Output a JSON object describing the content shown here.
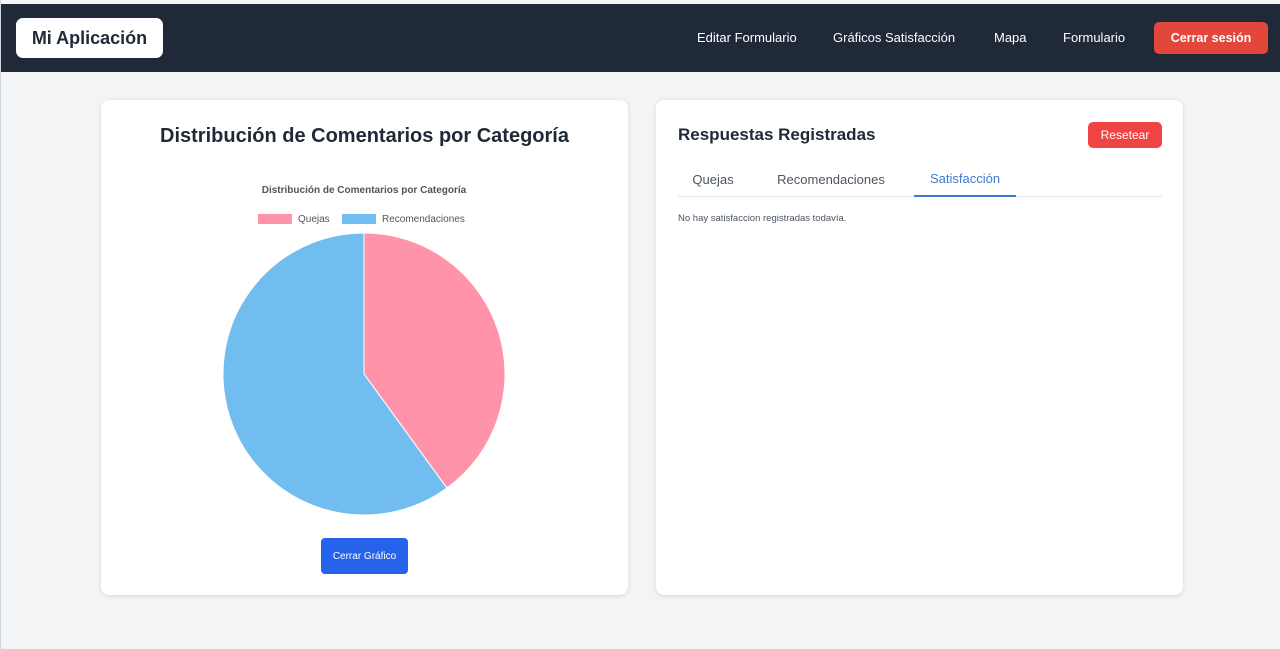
{
  "app": {
    "brand": "Mi Aplicación"
  },
  "nav": {
    "items": [
      "Editar Formulario",
      "Gráficos Satisfacción",
      "Mapa",
      "Formulario"
    ],
    "logout_label": "Cerrar sesión"
  },
  "left_card": {
    "title": "Distribución de Comentarios por Categoría",
    "close_label": "Cerrar Gráfico"
  },
  "chart_data": {
    "type": "pie",
    "title": "Distribución de Comentarios por Categoría",
    "categories": [
      "Quejas",
      "Recomendaciones"
    ],
    "values": [
      40,
      60
    ],
    "colors": [
      "#ff93aa",
      "#72bdf0"
    ],
    "legend": "top"
  },
  "right_card": {
    "title": "Respuestas Registradas",
    "reset_label": "Resetear",
    "tabs": [
      "Quejas",
      "Recomendaciones",
      "Satisfacción"
    ],
    "active_tab": "Satisfacción",
    "empty_message": "No hay satisfaccion registradas todavía."
  }
}
